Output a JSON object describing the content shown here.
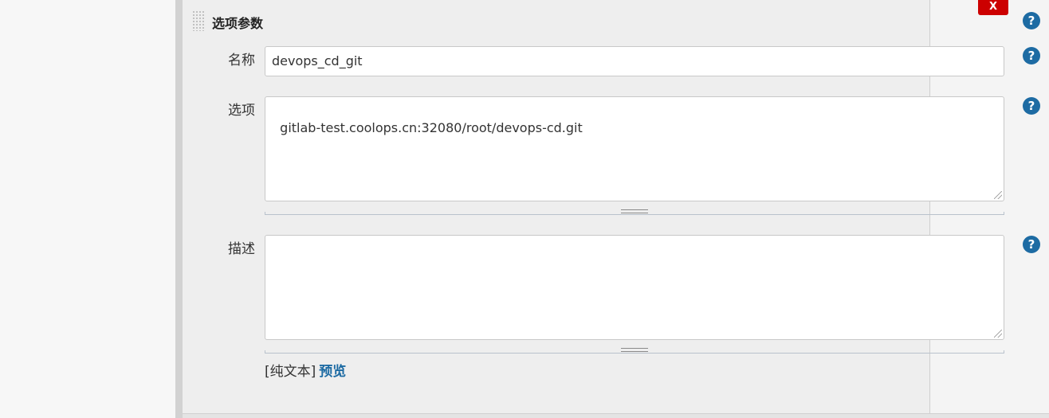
{
  "section": {
    "title": "选项参数",
    "delete_label": "X",
    "help_glyph": "?"
  },
  "fields": {
    "name": {
      "label": "名称",
      "value": "devops_cd_git"
    },
    "choices": {
      "label": "选项",
      "value": "gitlab-test.coolops.cn:32080/root/devops-cd.git"
    },
    "description": {
      "label": "描述",
      "value": "",
      "format_prefix": "[纯文本]",
      "preview_label": "预览"
    }
  },
  "colors": {
    "accent": "#1d6ba3",
    "danger": "#cc0000"
  }
}
